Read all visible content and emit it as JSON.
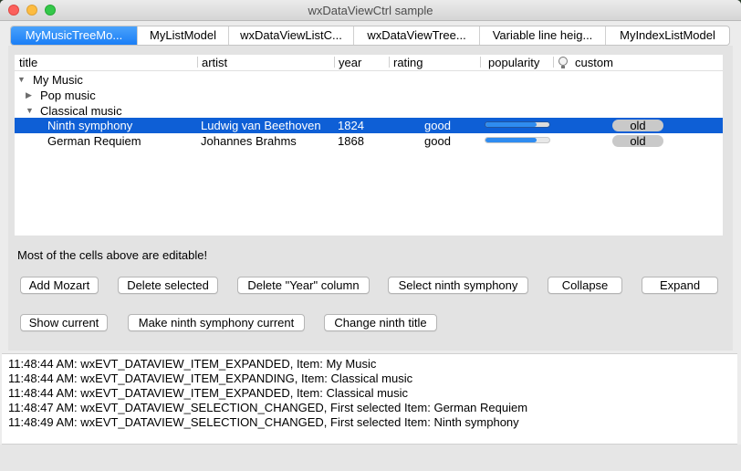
{
  "window": {
    "title": "wxDataViewCtrl sample"
  },
  "tabs": [
    {
      "label": "MyMusicTreeMo...",
      "active": true
    },
    {
      "label": "MyListModel",
      "active": false
    },
    {
      "label": "wxDataViewListC...",
      "active": false
    },
    {
      "label": "wxDataViewTree...",
      "active": false
    },
    {
      "label": "Variable line heig...",
      "active": false
    },
    {
      "label": "MyIndexListModel",
      "active": false
    }
  ],
  "tree": {
    "columns": {
      "title": "title",
      "artist": "artist",
      "year": "year",
      "rating": "rating",
      "popularity": "popularity",
      "custom": "custom"
    },
    "custom_icon": "lightbulb-icon",
    "rows": [
      {
        "title": "My Music",
        "expander": "expanded"
      },
      {
        "title": "Pop music",
        "expander": "collapsed"
      },
      {
        "title": "Classical music",
        "expander": "expanded"
      },
      {
        "title": "Ninth symphony",
        "artist": "Ludwig van Beethoven",
        "year": "1824",
        "rating": "good",
        "popularity": 0.8,
        "custom": "old",
        "selected": true
      },
      {
        "title": "German Requiem",
        "artist": "Johannes Brahms",
        "year": "1868",
        "rating": "good",
        "popularity": 0.8,
        "custom": "old",
        "selected": false
      }
    ]
  },
  "note": "Most of the cells above are editable!",
  "buttons": {
    "add_mozart": "Add Mozart",
    "delete_selected": "Delete selected",
    "delete_year": "Delete \"Year\" column",
    "select_ninth": "Select ninth symphony",
    "collapse": "Collapse",
    "expand": "Expand",
    "show_current": "Show current",
    "make_current": "Make ninth symphony current",
    "change_title": "Change ninth title"
  },
  "log": [
    "11:48:44 AM: wxEVT_DATAVIEW_ITEM_EXPANDED, Item: My Music",
    "11:48:44 AM: wxEVT_DATAVIEW_ITEM_EXPANDING, Item: Classical music",
    "11:48:44 AM: wxEVT_DATAVIEW_ITEM_EXPANDED, Item: Classical music",
    "11:48:47 AM: wxEVT_DATAVIEW_SELECTION_CHANGED, First selected Item: German Requiem",
    "11:48:49 AM: wxEVT_DATAVIEW_SELECTION_CHANGED, First selected Item: Ninth symphony"
  ],
  "colors": {
    "selection": "#0e5fd6",
    "accent": "#1a7ef6",
    "progress": "#2f8cf0"
  }
}
